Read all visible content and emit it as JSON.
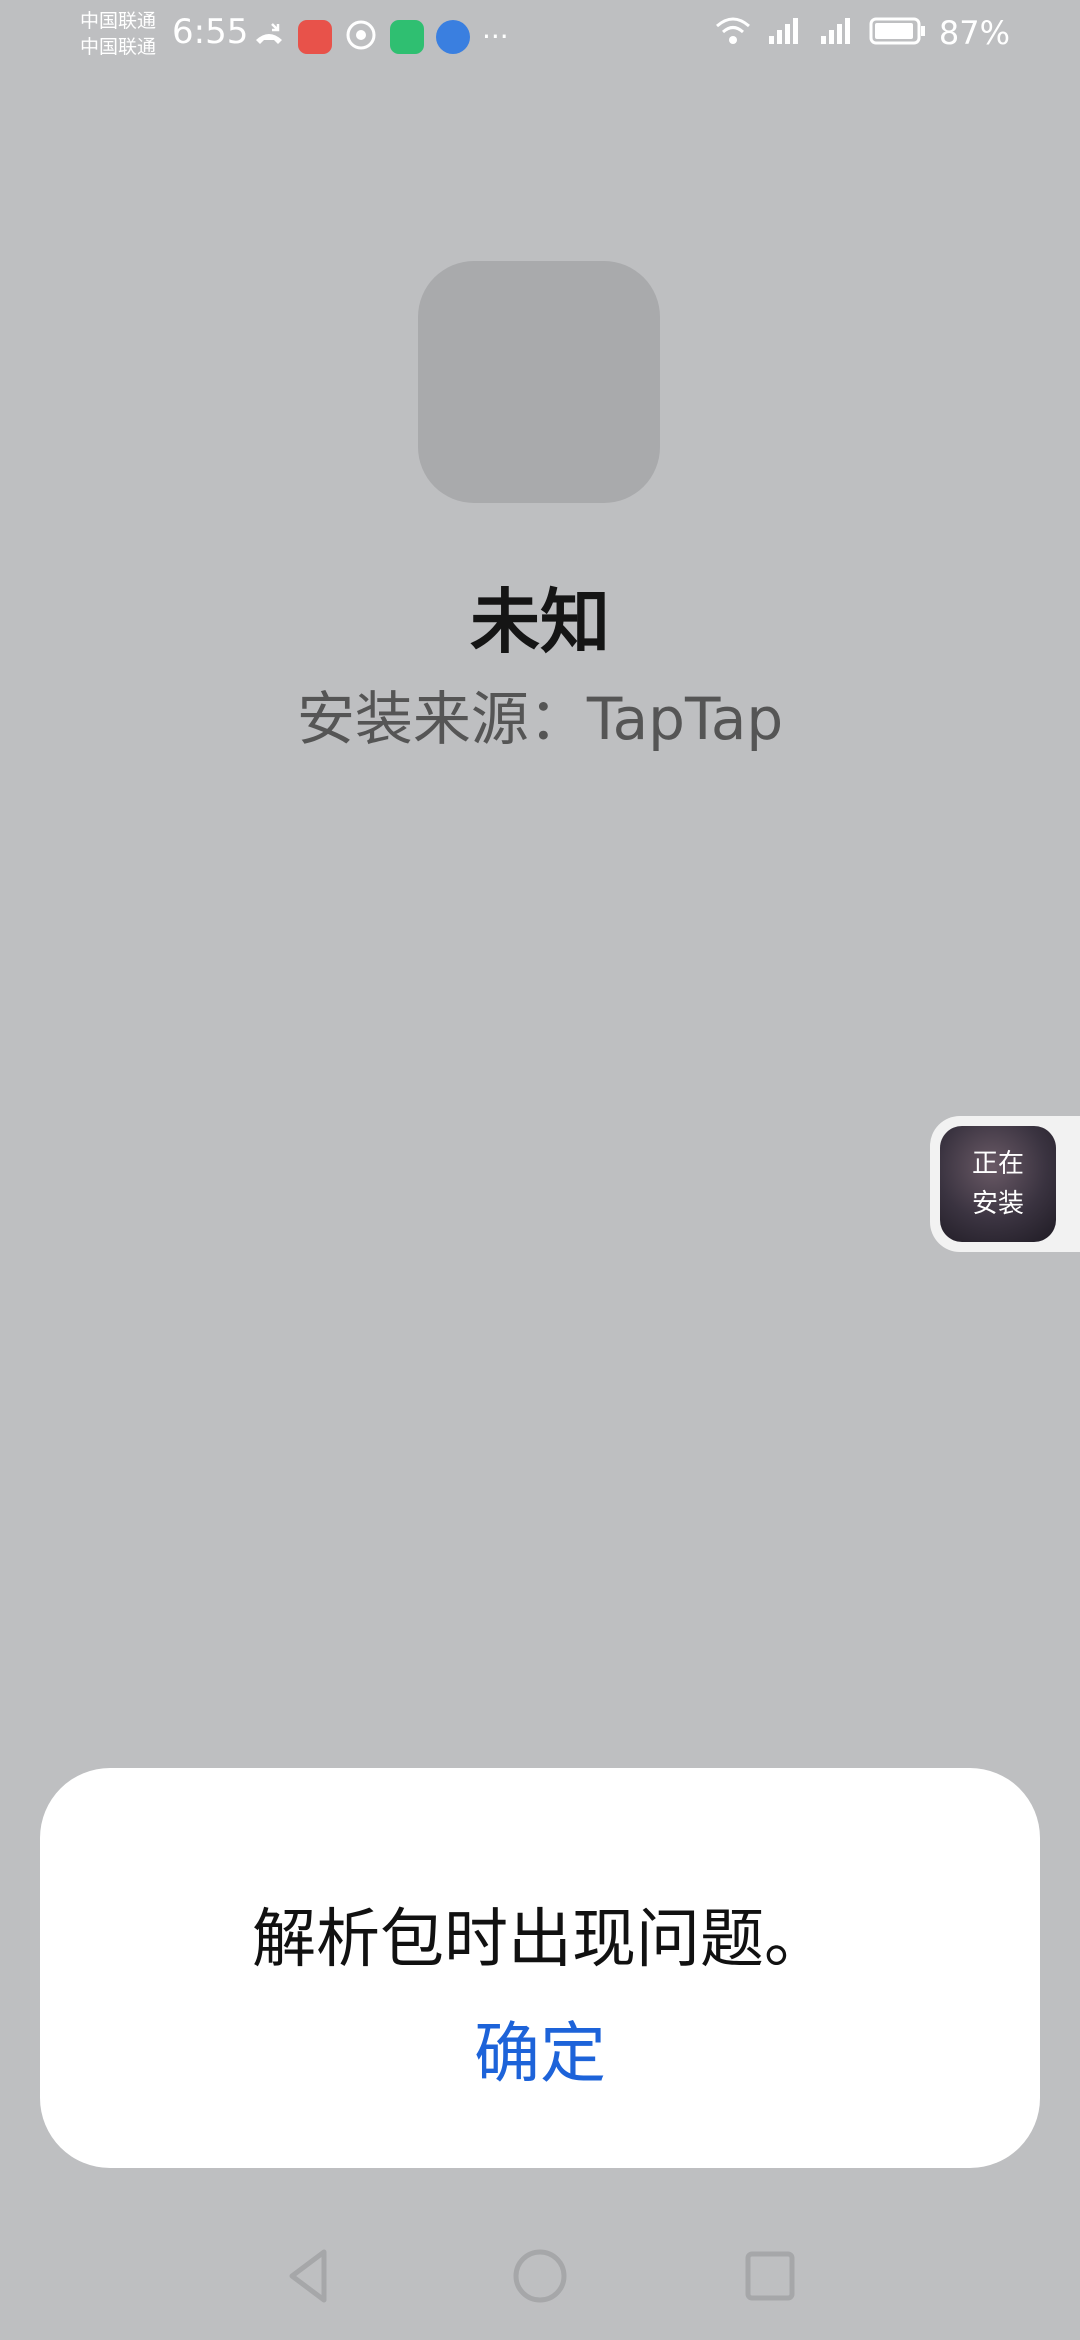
{
  "status_bar": {
    "carrier_1": "中国联通",
    "carrier_2": "中国联通",
    "time": "6:55",
    "battery": "87%",
    "icons": [
      "missed-call-icon",
      "huawei-app-icon",
      "location-icon",
      "app-icon",
      "browser-icon",
      "more-dots-icon"
    ],
    "right_icons": [
      "wifi-icon",
      "signal-4g-icon",
      "signal-4g-icon",
      "battery-icon"
    ]
  },
  "app": {
    "name": "未知",
    "install_source": "安装来源：TapTap"
  },
  "installing_bubble": {
    "line1": "正在",
    "line2": "安装"
  },
  "dialog": {
    "message": "解析包时出现问题。",
    "confirm_label": "确定",
    "confirm_color": "#1d63d9"
  },
  "nav": {
    "buttons": [
      "back-triangle-icon",
      "home-circle-icon",
      "recents-square-icon"
    ]
  }
}
